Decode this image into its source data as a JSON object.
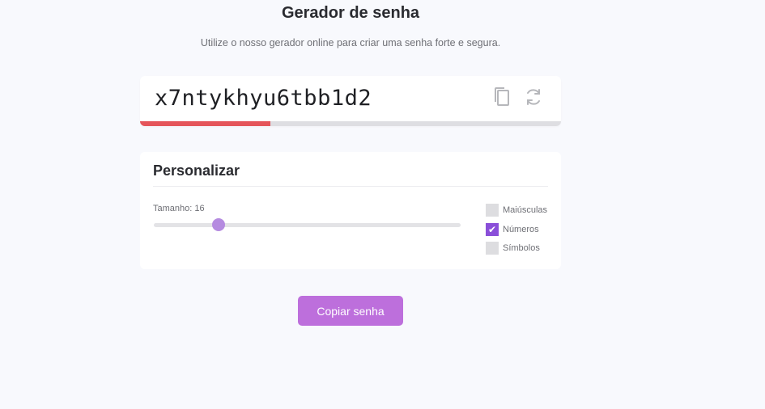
{
  "header": {
    "title": "Gerador de senha",
    "subtitle": "Utilize o nosso gerador online para criar uma senha forte e segura."
  },
  "password": {
    "value": "x7ntykhyu6tbb1d2",
    "strength_fraction": 0.31,
    "strength_color": "#e5555a",
    "copy_icon": "copy-icon",
    "refresh_icon": "refresh-icon"
  },
  "customize": {
    "title": "Personalizar",
    "length_label": "Tamanho: 16",
    "length_value": 16,
    "slider_fraction": 0.21,
    "options": [
      {
        "label": "Maiúsculas",
        "checked": false
      },
      {
        "label": "Números",
        "checked": true
      },
      {
        "label": "Símbolos",
        "checked": false
      }
    ]
  },
  "actions": {
    "copy_label": "Copiar senha"
  },
  "colors": {
    "accent": "#bd6fdc",
    "checkbox_checked": "#8a4fd9",
    "slider_thumb": "#b58be0"
  }
}
